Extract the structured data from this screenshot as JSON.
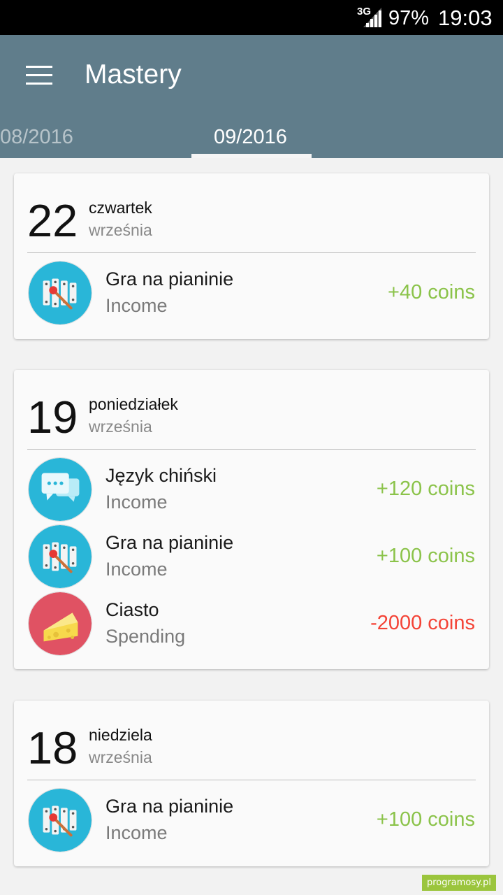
{
  "status_bar": {
    "network": "3G",
    "battery": "97%",
    "time": "19:03"
  },
  "app_bar": {
    "title": "Mastery",
    "tabs": [
      {
        "label": "08/2016",
        "selected": false
      },
      {
        "label": "09/2016",
        "selected": true
      }
    ]
  },
  "days": [
    {
      "day": "22",
      "weekday": "czwartek",
      "month": "września",
      "entries": [
        {
          "name": "Gra na pianinie",
          "type": "Income",
          "amount": "+40 coins",
          "icon": "xylophone-icon"
        }
      ]
    },
    {
      "day": "19",
      "weekday": "poniedziałek",
      "month": "września",
      "entries": [
        {
          "name": "Język chiński",
          "type": "Income",
          "amount": "+120 coins",
          "icon": "chat-bubbles-icon"
        },
        {
          "name": "Gra na pianinie",
          "type": "Income",
          "amount": "+100 coins",
          "icon": "xylophone-icon"
        },
        {
          "name": "Ciasto",
          "type": "Spending",
          "amount": "-2000 coins",
          "icon": "cheese-icon"
        }
      ]
    },
    {
      "day": "18",
      "weekday": "niedziela",
      "month": "września",
      "entries": [
        {
          "name": "Gra na pianinie",
          "type": "Income",
          "amount": "+100 coins",
          "icon": "xylophone-icon"
        }
      ]
    }
  ],
  "watermark": "programosy.pl",
  "colors": {
    "app_bar": "#607d8b",
    "income": "#8bc34a",
    "spending": "#f44336",
    "icon_blue": "#29b6d8",
    "icon_red": "#e05263"
  }
}
